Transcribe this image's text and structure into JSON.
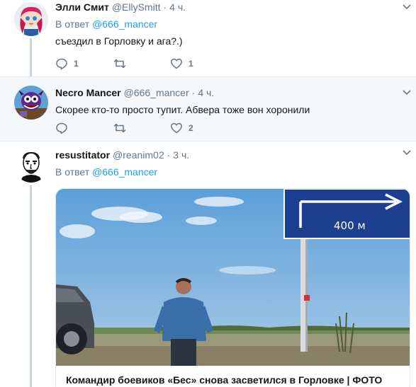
{
  "tweets": [
    {
      "name": "Элли Смит",
      "handle": "@EllySmitt",
      "dot": "·",
      "time": "4 ч.",
      "reply_prefix": "В ответ",
      "reply_mention": "@666_mancer",
      "text": "съездил в Горловку и ага?.)",
      "reply_count": "1",
      "retweet_count": "",
      "like_count": "1"
    },
    {
      "name": "Necro Mancer",
      "handle": "@666_mancer",
      "dot": "·",
      "time": "4 ч.",
      "text": "Скорее кто-то просто тупит. Абвера тоже вон хоронили",
      "reply_count": "",
      "retweet_count": "",
      "like_count": "2"
    },
    {
      "name": "resustitator",
      "handle": "@reanim02",
      "dot": "·",
      "time": "3 ч.",
      "reply_prefix": "В ответ",
      "reply_mention": "@666_mancer",
      "card": {
        "title": "Командир боевиков «Бес» снова засветился в Горловке | ФОТО",
        "sign_text": "400 м"
      }
    }
  ],
  "colors": {
    "link": "#1da1f2",
    "secondary_text": "#657786",
    "highlight_bg": "#f5f8fa"
  },
  "icons": [
    "reply-icon",
    "retweet-icon",
    "like-icon",
    "chevron-down-icon"
  ]
}
